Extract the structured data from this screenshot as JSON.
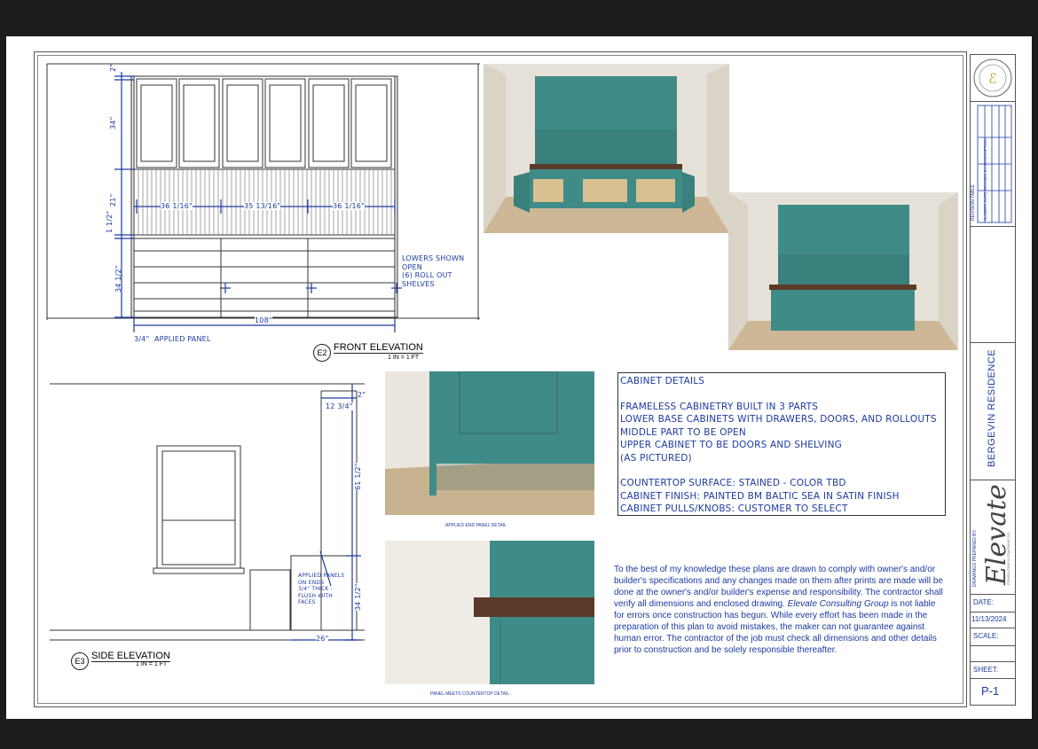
{
  "drawings": {
    "front": {
      "title": "FRONT ELEVATION",
      "code": "E2",
      "scale": "1 IN = 1 FT",
      "dims": {
        "top": "2\"",
        "upper": "34\"",
        "mid": "21\"",
        "gap": "1 1/2\"",
        "lower": "34 1/2\"",
        "w1": "36 1/16\"",
        "w2": "35 13/16\"",
        "w3": "36 1/16\"",
        "total": "108\"",
        "panel": "3/4\""
      },
      "panel_label": "APPLIED PANEL",
      "note": [
        "LOWERS SHOWN",
        "OPEN",
        "(6) ROLL OUT",
        "SHELVES"
      ]
    },
    "side": {
      "title": "SIDE ELEVATION",
      "code": "E3",
      "scale": "1 IN = 1 FT",
      "dims": {
        "top": "2\"",
        "depth_top": "12 3/4\"",
        "upper": "61 1/2\"",
        "lower": "34 1/2\"",
        "depth": "26\""
      },
      "note": [
        "APPLIED PANELS",
        "ON ENDS",
        "3/4\" THICK -",
        "FLUSH WITH",
        "FACES"
      ]
    }
  },
  "captions": {
    "end_panel": "APPLIED END PANEL DETAIL",
    "countertop": "PANEL MEETS COUNTERTOP DETAIL"
  },
  "details": {
    "title": "CABINET DETAILS",
    "lines": [
      "FRAMELESS CABINETRY BUILT IN 3 PARTS",
      "LOWER BASE CABINETS WITH DRAWERS, DOORS, AND ROLLOUTS",
      "MIDDLE PART TO BE OPEN",
      "UPPER CABINET TO BE DOORS AND SHELVING",
      "(AS PICTURED)",
      "",
      "COUNTERTOP SURFACE: STAINED - COLOR TBD",
      "CABINET FINISH: PAINTED BM BALTIC SEA IN SATIN FINISH",
      "CABINET PULLS/KNOBS: CUSTOMER TO SELECT"
    ]
  },
  "disclaimer": {
    "part1": "To the best of my knowledge these plans are drawn to comply with owner's and/or builder's specifications and any changes made on them after prints are made will be done at the owner's and/or builder's expense and responsibility. The contractor shall verify all dimensions and enclosed drawing.",
    "company": "Elevate Consulting Group",
    "part2": "is not liable for errors once construction has begun. While every effort has been made in the preparation of this plan to avoid mistakes, the maker can not guarantee against human error. The contractor of the job must check all dimensions and other details prior to construction and be solely responsible thereafter."
  },
  "title_block": {
    "revision_table": "REVISION TABLE",
    "rev_headers": [
      "NUMBER",
      "DATE",
      "REVISED BY",
      "DESCRIPTION"
    ],
    "project": "BERGEVIN RESIDENCE",
    "prepared_by": "DRAWINGS PREPARED BY:",
    "logo_word": "Elevate",
    "logo_sub": "CONSULTING & COACHING CO.",
    "seal_text": "ELEVATE COACHING & CONSULTING",
    "date_label": "DATE:",
    "date": "11/13/2024",
    "scale_label": "SCALE:",
    "sheet_label": "SHEET:",
    "sheet": "P-1"
  },
  "colors": {
    "ink": "#1c3aa1",
    "cabinet": "#3f8b88",
    "wood": "#5a3a28",
    "floor": "#c9b597"
  }
}
